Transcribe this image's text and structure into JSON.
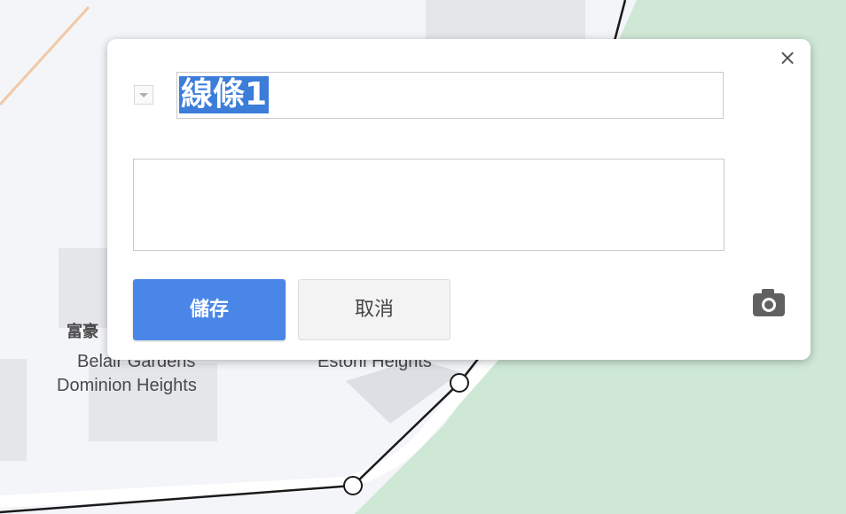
{
  "map": {
    "labels": {
      "place_a_chinese": "富豪",
      "place_a_line1": "Belair Gardens",
      "place_a_line2": "Dominion Heights",
      "place_b": "Estoril Heights"
    },
    "colors": {
      "background": "#f3f5f8",
      "park": "#cfe8d6",
      "building": "#e4e6e9",
      "road_line": "#1a1a1a"
    }
  },
  "dialog": {
    "close_label": "×",
    "title_value": "線條1",
    "description_value": "",
    "save_label": "儲存",
    "cancel_label": "取消",
    "dropdown_icon": "chevron-down-icon",
    "camera_icon": "camera-icon",
    "colors": {
      "primary": "#4a86e8",
      "selection": "#3b7dd8"
    }
  }
}
